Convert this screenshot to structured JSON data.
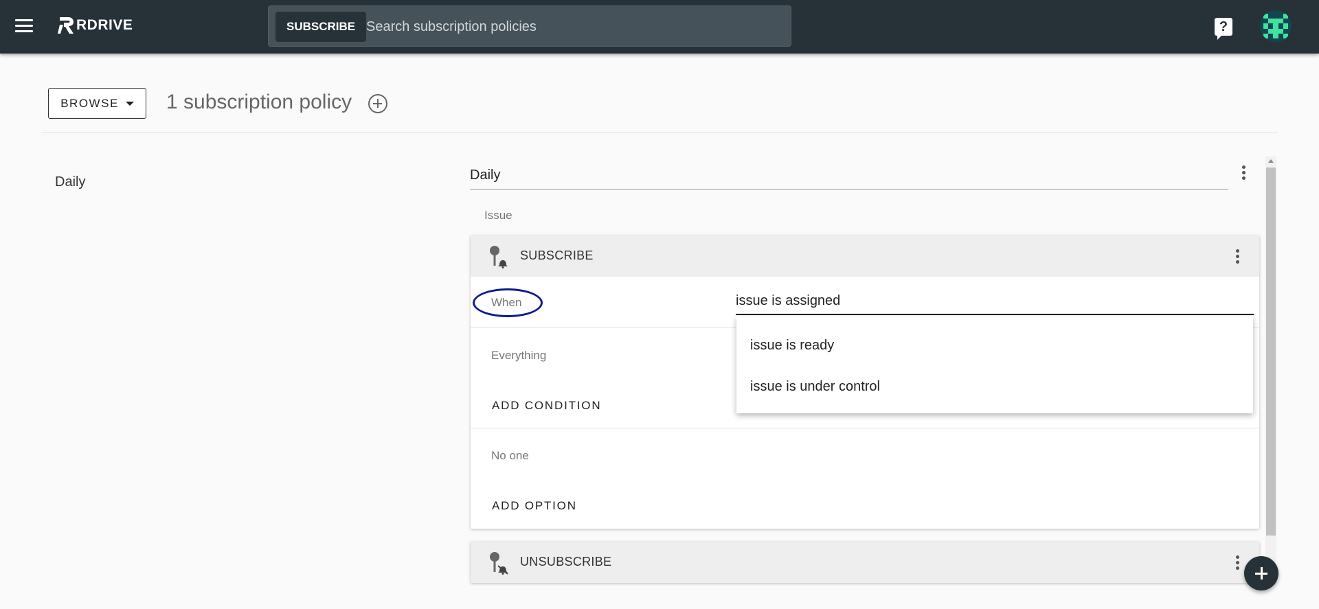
{
  "topbar": {
    "logo_text": "RDRIVE",
    "search_chip": "SUBSCRIBE",
    "search_placeholder": "Search subscription policies",
    "help_icon": "help-icon",
    "avatar_icon": "pixel-avatar",
    "brand_color": "#263238",
    "avatar_accent": "#3ee3a0"
  },
  "header": {
    "browse_label": "BROWSE",
    "title": "1 subscription policy"
  },
  "policies": [
    {
      "label": "Daily"
    }
  ],
  "detail": {
    "name": "Daily",
    "section_label": "Issue",
    "subscribe_card": {
      "title": "SUBSCRIBE",
      "when_label": "When",
      "when_value": "issue is assigned",
      "condition_text": "Everything",
      "add_condition_label": "ADD CONDITION",
      "option_text": "No one",
      "add_option_label": "ADD OPTION"
    },
    "dropdown_options": [
      "issue is ready",
      "issue is under control"
    ],
    "unsubscribe_card": {
      "title": "UNSUBSCRIBE"
    },
    "highlight_color": "#0d1b8f"
  }
}
